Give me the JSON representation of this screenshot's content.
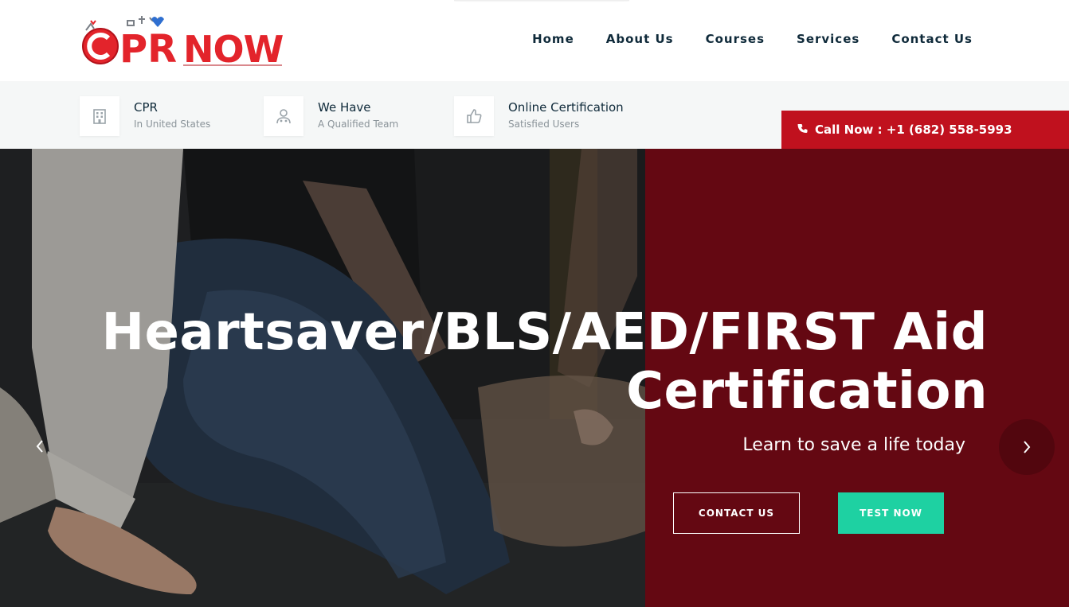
{
  "brand": {
    "logo_text": "CPR NOW",
    "logo_colors": {
      "red": "#e3242b",
      "dark_red": "#b3111a",
      "gray": "#7a7f86",
      "blue": "#2f6fd0"
    }
  },
  "nav": {
    "items": [
      {
        "label": "Home"
      },
      {
        "label": "About Us"
      },
      {
        "label": "Courses"
      },
      {
        "label": "Services"
      },
      {
        "label": "Contact Us"
      }
    ]
  },
  "infobar": {
    "items": [
      {
        "title": "CPR",
        "subtitle": "In United States",
        "icon": "building-icon"
      },
      {
        "title": "We Have",
        "subtitle": "A Qualified Team",
        "icon": "doctor-icon"
      },
      {
        "title": "Online Certification",
        "subtitle": "Satisfied Users",
        "icon": "thumbs-up-icon"
      }
    ],
    "callnow": {
      "label": "Call Now : +1 (682) 558-5993",
      "icon": "phone-icon"
    }
  },
  "hero": {
    "title_line1": "Heartsaver/BLS/AED/FIRST Aid",
    "title_line2": "Certification",
    "subtitle": "Learn to save a life today",
    "contact_button": "CONTACT US",
    "test_button": "TEST NOW",
    "colors": {
      "accent_red": "#c0111e",
      "panel_red": "#640812",
      "teal": "#1ed1a2"
    }
  }
}
